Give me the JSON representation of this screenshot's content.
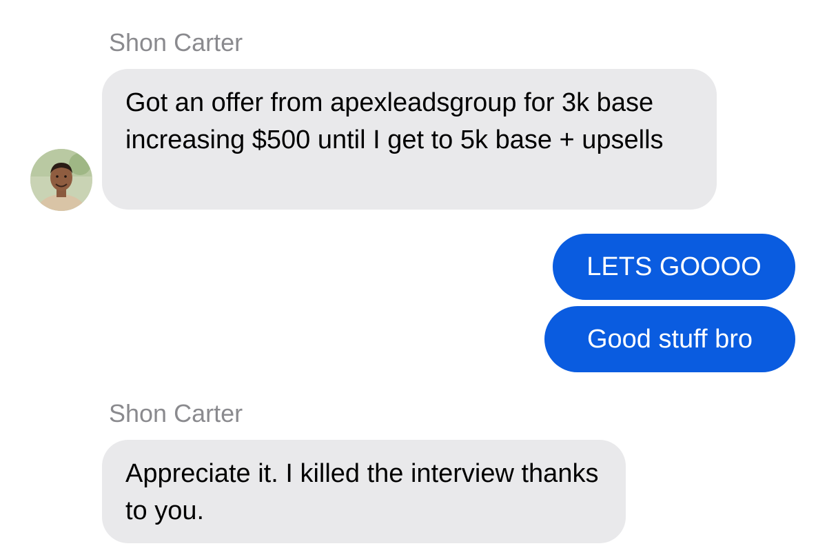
{
  "conversation": {
    "contact_name": "Shon Carter",
    "groups": [
      {
        "sender": "Shon Carter",
        "messages": [
          "Got an offer from apexleadsgroup for 3k base increasing $500 until I get to 5k base + upsells"
        ]
      },
      {
        "sender": "me",
        "messages": [
          "LETS GOOOO",
          "Good stuff bro"
        ]
      },
      {
        "sender": "Shon Carter",
        "messages": [
          "Appreciate it. I killed the interview thanks to you."
        ]
      }
    ]
  },
  "colors": {
    "incoming_bubble": "#e9e9eb",
    "outgoing_bubble": "#0a5ce0",
    "sender_name": "#8a8a8e"
  },
  "icons": {
    "avatar": "contact-photo"
  }
}
